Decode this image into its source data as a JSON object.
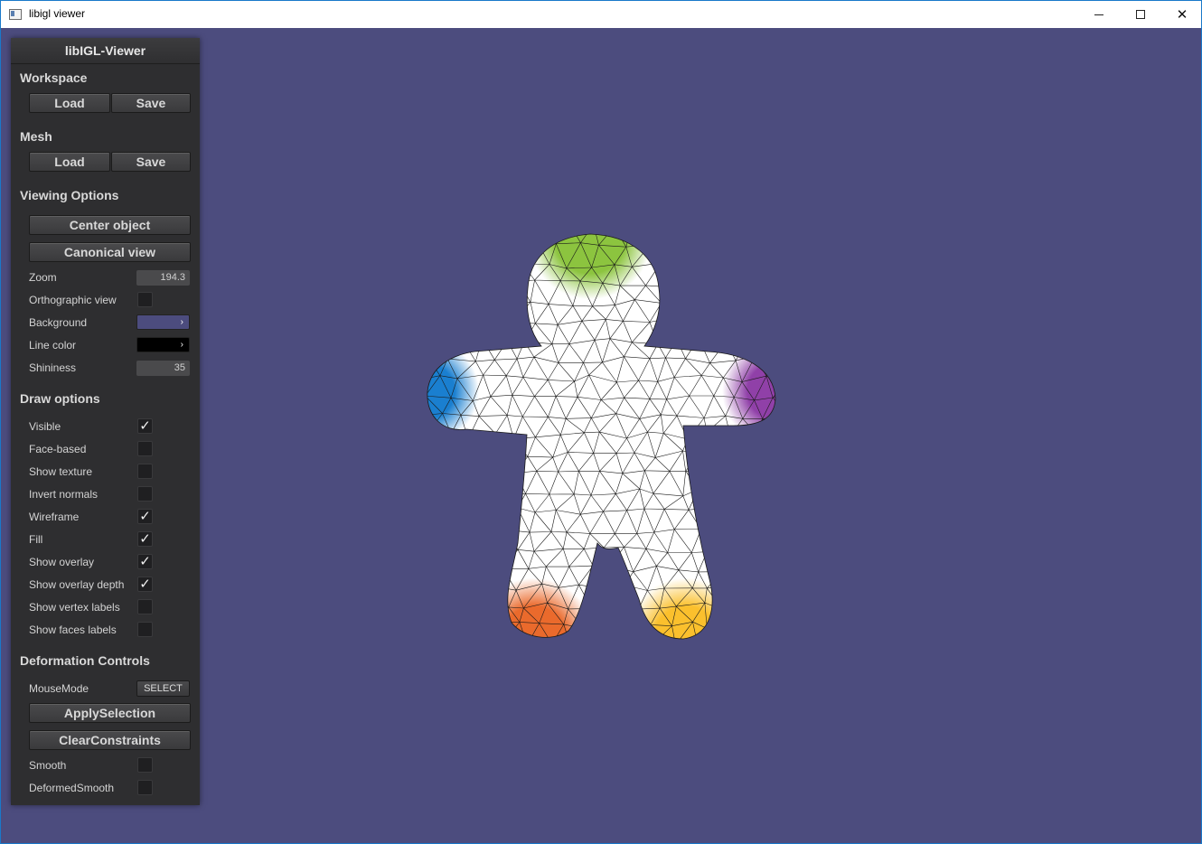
{
  "window": {
    "title": "libigl viewer"
  },
  "panel": {
    "title": "libIGL-Viewer",
    "workspace": {
      "title": "Workspace",
      "load": "Load",
      "save": "Save"
    },
    "mesh": {
      "title": "Mesh",
      "load": "Load",
      "save": "Save"
    },
    "viewing": {
      "title": "Viewing Options",
      "center": "Center object",
      "canonical": "Canonical view",
      "zoom_label": "Zoom",
      "zoom_value": "194.3",
      "ortho_label": "Orthographic view",
      "ortho_checked": false,
      "background_label": "Background",
      "background_color": "#4c4c7e",
      "linecolor_label": "Line color",
      "line_color": "#000000",
      "shininess_label": "Shininess",
      "shininess_value": "35"
    },
    "draw": {
      "title": "Draw options",
      "items": [
        {
          "label": "Visible",
          "checked": true
        },
        {
          "label": "Face-based",
          "checked": false
        },
        {
          "label": "Show texture",
          "checked": false
        },
        {
          "label": "Invert normals",
          "checked": false
        },
        {
          "label": "Wireframe",
          "checked": true
        },
        {
          "label": "Fill",
          "checked": true
        },
        {
          "label": "Show overlay",
          "checked": true
        },
        {
          "label": "Show overlay depth",
          "checked": true
        },
        {
          "label": "Show vertex labels",
          "checked": false
        },
        {
          "label": "Show faces labels",
          "checked": false
        }
      ]
    },
    "deformation": {
      "title": "Deformation Controls",
      "mousemode_label": "MouseMode",
      "mousemode_value": "SELECT",
      "apply": "ApplySelection",
      "clear": "ClearConstraints",
      "smooth_label": "Smooth",
      "smooth_checked": false,
      "deformedsmooth_label": "DeformedSmooth",
      "deformedsmooth_checked": false
    }
  },
  "mesh_colors": {
    "head": "#8cc43f",
    "left_hand": "#1a7fd0",
    "right_hand": "#9040a8",
    "left_foot": "#ea6a2c",
    "right_foot": "#fbc02d",
    "body": "#ffffff"
  }
}
